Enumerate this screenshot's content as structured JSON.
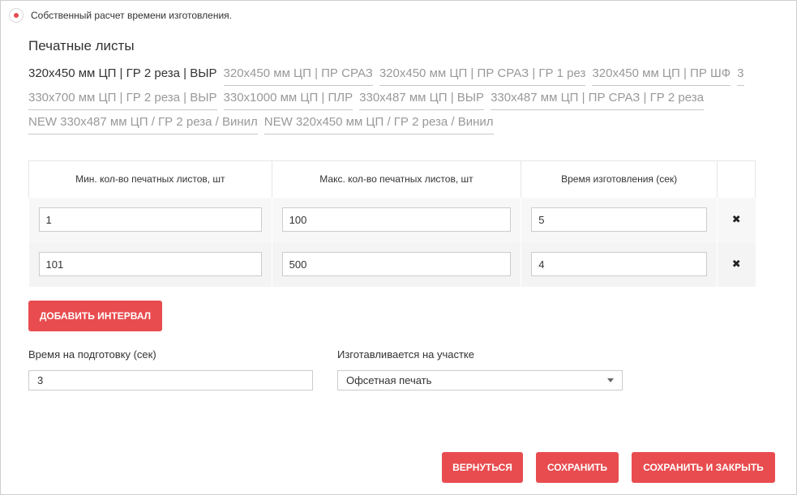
{
  "own_calc": {
    "label": "Собственный расчет времени изготовления.",
    "selected": true
  },
  "section_title": "Печатные листы",
  "tabs": {
    "row1": [
      {
        "label": "320x450 мм ЦП | ГР 2 реза | ВЫР",
        "active": true
      },
      {
        "label": "320x450 мм ЦП | ПР СРАЗ",
        "active": false
      },
      {
        "label": "320x450 мм ЦП | ПР СРАЗ | ГР 1 рез",
        "active": false
      },
      {
        "label": "320x450 мм ЦП | ПР ШФ",
        "active": false
      },
      {
        "label": "3",
        "active": false
      }
    ],
    "row2": [
      {
        "label": "330x700 мм ЦП | ГР 2 реза | ВЫР",
        "active": false
      },
      {
        "label": "330x1000 мм ЦП | ПЛР",
        "active": false
      },
      {
        "label": "330x487 мм ЦП | ВЫР",
        "active": false
      },
      {
        "label": "330x487 мм ЦП | ПР СРАЗ | ГР 2 реза",
        "active": false
      }
    ],
    "row3": [
      {
        "label": "NEW 330x487 мм ЦП / ГР 2 реза / Винил",
        "active": false
      },
      {
        "label": "NEW 320x450 мм ЦП / ГР 2 реза / Винил",
        "active": false
      }
    ]
  },
  "table": {
    "headers": [
      "Мин. кол-во печатных листов, шт",
      "Макс. кол-во печатных листов, шт",
      "Время изготовления (сек)"
    ],
    "rows": [
      {
        "min": "1",
        "max": "100",
        "time": "5"
      },
      {
        "min": "101",
        "max": "500",
        "time": "4"
      }
    ],
    "delete_glyph": "✖"
  },
  "add_interval_label": "Добавить интервал",
  "prep": {
    "label": "Время на подготовку (сек)",
    "value": "3"
  },
  "site": {
    "label": "Изготавливается на участке",
    "value": "Офсетная печать"
  },
  "footer": {
    "back_label": "Вернуться",
    "save_label": "Сохранить",
    "save_close_label": "Сохранить и закрыть"
  },
  "colors": {
    "accent": "#e84c4f",
    "tab_inactive": "#999999"
  }
}
